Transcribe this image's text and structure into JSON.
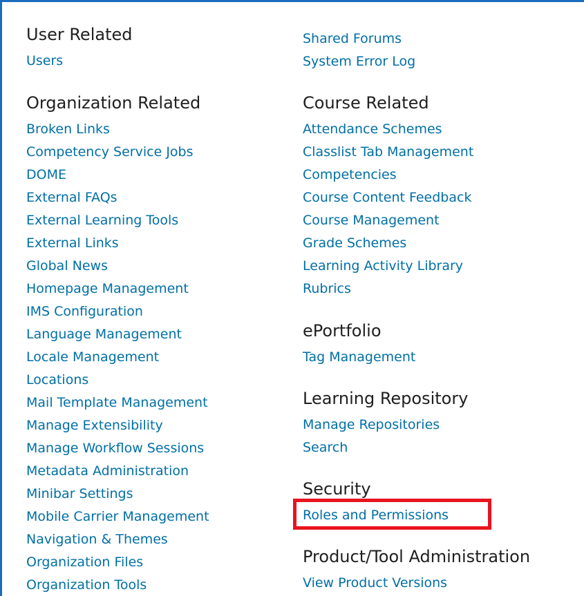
{
  "left_column": {
    "user_related": {
      "heading": "User Related",
      "links": [
        "Users"
      ]
    },
    "organization_related": {
      "heading": "Organization Related",
      "links": [
        "Broken Links",
        "Competency Service Jobs",
        "DOME",
        "External FAQs",
        "External Learning Tools",
        "External Links",
        "Global News",
        "Homepage Management",
        "IMS Configuration",
        "Language Management",
        "Locale Management",
        "Locations",
        "Mail Template Management",
        "Manage Extensibility",
        "Manage Workflow Sessions",
        "Metadata Administration",
        "Minibar Settings",
        "Mobile Carrier Management",
        "Navigation & Themes",
        "Organization Files",
        "Organization Tools"
      ]
    }
  },
  "right_column": {
    "misc": {
      "links": [
        "Shared Forums",
        "System Error Log"
      ]
    },
    "course_related": {
      "heading": "Course Related",
      "links": [
        "Attendance Schemes",
        "Classlist Tab Management",
        "Competencies",
        "Course Content Feedback",
        "Course Management",
        "Grade Schemes",
        "Learning Activity Library",
        "Rubrics"
      ]
    },
    "eportfolio": {
      "heading": "ePortfolio",
      "links": [
        "Tag Management"
      ]
    },
    "learning_repository": {
      "heading": "Learning Repository",
      "links": [
        "Manage Repositories",
        "Search"
      ]
    },
    "security": {
      "heading": "Security",
      "links": [
        "Roles and Permissions"
      ]
    },
    "product_tool_administration": {
      "heading": "Product/Tool Administration",
      "links": [
        "View Product Versions"
      ]
    }
  },
  "colors": {
    "frame_border": "#1b6bbd",
    "link": "#006fa6",
    "heading": "#202020",
    "highlight": "#e8141e"
  }
}
